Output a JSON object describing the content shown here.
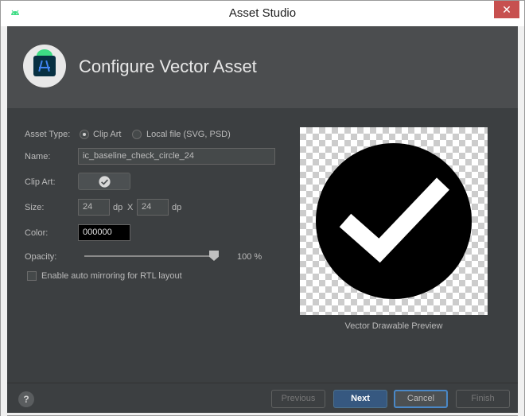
{
  "window": {
    "title": "Asset Studio",
    "close_glyph": "✕"
  },
  "header": {
    "title": "Configure Vector Asset"
  },
  "form": {
    "asset_type_label": "Asset Type:",
    "asset_type_options": [
      "Clip Art",
      "Local file (SVG, PSD)"
    ],
    "asset_type_selected": "Clip Art",
    "name_label": "Name:",
    "name_value": "ic_baseline_check_circle_24",
    "clip_art_label": "Clip Art:",
    "clip_art_icon": "check-circle-icon",
    "size_label": "Size:",
    "width_value": "24",
    "height_value": "24",
    "unit": "dp",
    "size_separator": "X",
    "color_label": "Color:",
    "color_value": "000000",
    "opacity_label": "Opacity:",
    "opacity_value": 100,
    "opacity_text": "100 %",
    "auto_mirror_label": "Enable auto mirroring for RTL layout",
    "auto_mirror_checked": false
  },
  "preview": {
    "caption": "Vector Drawable Preview",
    "icon": "check-circle-icon",
    "fill": "#000000"
  },
  "footer": {
    "help": "?",
    "previous": "Previous",
    "next": "Next",
    "cancel": "Cancel",
    "finish": "Finish"
  },
  "colors": {
    "background": "#3c3f41",
    "header": "#4b4d4f",
    "primary": "#365880",
    "close": "#c7504f"
  }
}
